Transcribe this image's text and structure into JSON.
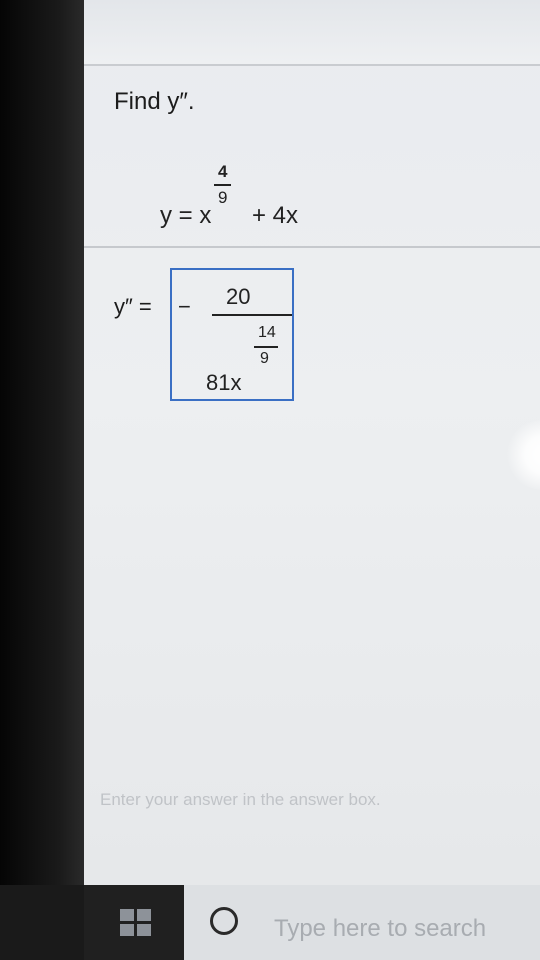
{
  "question": {
    "title": "Find y″."
  },
  "function": {
    "lhs_and_base": "y = x",
    "exponent_numerator": "4",
    "exponent_denominator": "9",
    "tail": "+ 4x"
  },
  "answer": {
    "label": "y″ =",
    "sign": "−",
    "numerator": "20",
    "coefficient": "81x",
    "exponent_numerator": "14",
    "exponent_denominator": "9"
  },
  "hint": "Enter your answer in the answer box.",
  "taskbar": {
    "start_icon": "windows-icon",
    "search_icon": "search-circle-icon",
    "search_placeholder": "Type here to search"
  }
}
